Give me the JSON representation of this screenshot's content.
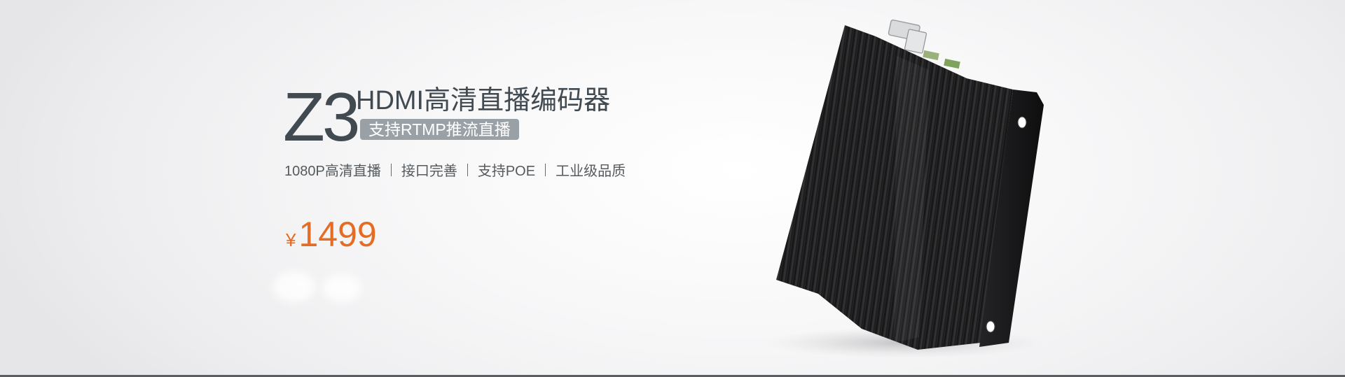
{
  "product": {
    "model": "Z3",
    "title": "HDMI高清直播编码器",
    "tag": "支持RTMP推流直播",
    "features": [
      "1080P高清直播",
      "接口完善",
      "支持POE",
      "工业级品质"
    ],
    "currency_symbol": "¥",
    "price": "1499",
    "image_name": "encoder-device-image"
  },
  "colors": {
    "model_text": "#414a51",
    "tag_bg": "#9aa1a6",
    "price": "#e56c24",
    "device_body": "#1c1c1e"
  }
}
